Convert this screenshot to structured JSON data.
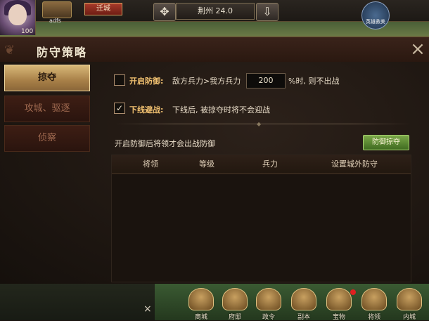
{
  "topbar": {
    "level": "100",
    "player_name": "adfs",
    "move_city_label": "迁城",
    "location": "荆州 24.0",
    "rescue_label": "英雄救美"
  },
  "dialog": {
    "title": "防守策略",
    "close_icon": "×"
  },
  "tabs": [
    {
      "label": "掠夺",
      "active": true
    },
    {
      "label": "攻城、驱逐",
      "active": false
    },
    {
      "label": "侦察",
      "active": false
    }
  ],
  "options": {
    "defense": {
      "checked": false,
      "title": "开启防御:",
      "text_before": "敌方兵力>我方兵力",
      "value": "200",
      "text_after": "%时, 则不出战"
    },
    "offline": {
      "checked": true,
      "check_mark": "✓",
      "title": "下线避战:",
      "text": "下线后, 被掠夺时将不会迎战"
    }
  },
  "section": {
    "note": "开启防御后将领才会出战防御",
    "guard_button": "防御掠夺"
  },
  "table": {
    "headers": [
      "将领",
      "等级",
      "兵力",
      "设置城外防守"
    ],
    "rows": []
  },
  "bottom_menu": {
    "close_icon": "×",
    "items": [
      "商城",
      "府邸",
      "政令",
      "副本",
      "宝物",
      "将领",
      "内城"
    ]
  }
}
